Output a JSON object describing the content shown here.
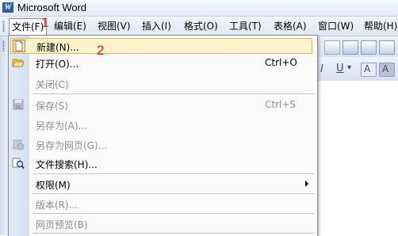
{
  "window": {
    "title": "Microsoft Word",
    "app_icon": "word-icon"
  },
  "menubar": {
    "items": [
      "文件(F)",
      "编辑(E)",
      "视图(V)",
      "插入(I)",
      "格式(O)",
      "工具(T)",
      "表格(A)",
      "窗口(W)",
      "帮助(H)"
    ],
    "active_index": 0
  },
  "annotations": {
    "step1": "1",
    "step2": "2"
  },
  "toolbar": {
    "underline_label": "U",
    "font_label": "A"
  },
  "file_menu": {
    "items": [
      {
        "label": "新建(N)...",
        "shortcut": "",
        "enabled": true,
        "icon": "new-document-icon",
        "highlighted": true
      },
      {
        "label": "打开(O)...",
        "shortcut": "Ctrl+O",
        "enabled": true,
        "icon": "open-folder-icon"
      },
      {
        "label": "关闭(C)",
        "shortcut": "",
        "enabled": false,
        "icon": ""
      },
      {
        "label": "保存(S)",
        "shortcut": "Ctrl+S",
        "enabled": false,
        "icon": "save-icon"
      },
      {
        "label": "另存为(A)...",
        "shortcut": "",
        "enabled": false,
        "icon": ""
      },
      {
        "label": "另存为网页(G)...",
        "shortcut": "",
        "enabled": false,
        "icon": "save-as-web-icon"
      },
      {
        "label": "文件搜索(H)...",
        "shortcut": "",
        "enabled": true,
        "icon": "file-search-icon"
      },
      {
        "label": "权限(M)",
        "shortcut": "",
        "enabled": true,
        "icon": "",
        "submenu": true
      },
      {
        "label": "版本(R)...",
        "shortcut": "",
        "enabled": false,
        "icon": ""
      },
      {
        "label": "网页预览(B)",
        "shortcut": "",
        "enabled": false,
        "icon": ""
      }
    ]
  },
  "colors": {
    "highlight_bg": "#fff3cd",
    "highlight_border": "#e8b64a",
    "annotation_red": "#e01818",
    "disabled_text": "#8d8d8d"
  }
}
